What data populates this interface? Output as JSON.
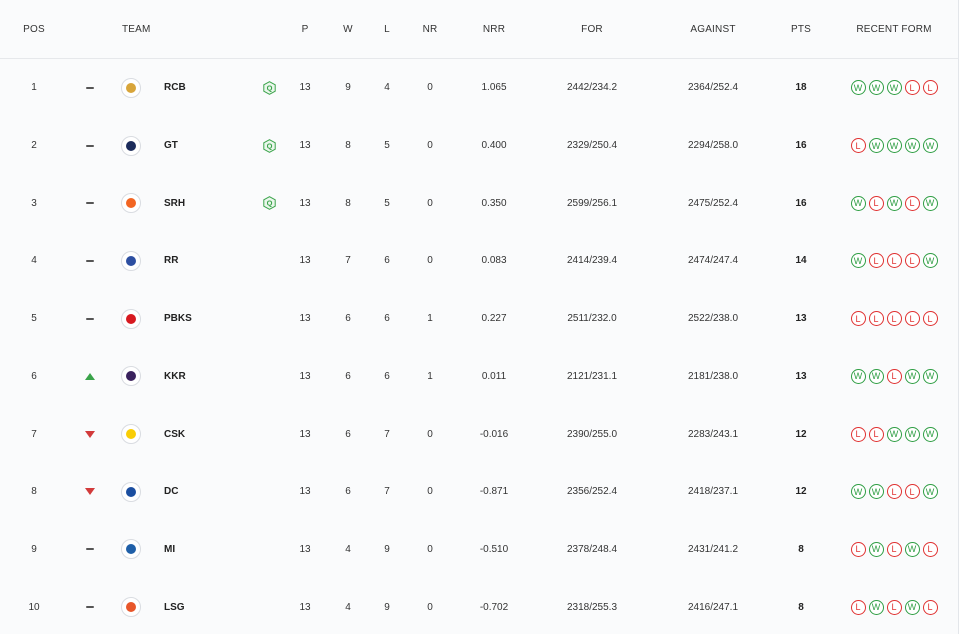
{
  "colors": {
    "win": "#2f9e44",
    "loss": "#e03131",
    "up": "#3aa34a",
    "down": "#d23b3b",
    "qualified": "#3aa34a"
  },
  "header": {
    "pos": "POS",
    "team": "TEAM",
    "p": "P",
    "w": "W",
    "l": "L",
    "nr": "NR",
    "nrr": "NRR",
    "for": "FOR",
    "against": "AGAINST",
    "pts": "PTS",
    "form": "RECENT FORM"
  },
  "rows": [
    {
      "pos": "1",
      "move": "same",
      "team": "RCB",
      "logo_color": "#d8a53a",
      "qualified": true,
      "qualified_label": "Q",
      "p": "13",
      "w": "9",
      "l": "4",
      "nr": "0",
      "nrr": "1.065",
      "for": "2442/234.2",
      "against": "2364/252.4",
      "pts": "18",
      "form": [
        "W",
        "W",
        "W",
        "L",
        "L"
      ]
    },
    {
      "pos": "2",
      "move": "same",
      "team": "GT",
      "logo_color": "#1c2c5b",
      "qualified": true,
      "qualified_label": "Q",
      "p": "13",
      "w": "8",
      "l": "5",
      "nr": "0",
      "nrr": "0.400",
      "for": "2329/250.4",
      "against": "2294/258.0",
      "pts": "16",
      "form": [
        "L",
        "W",
        "W",
        "W",
        "W"
      ]
    },
    {
      "pos": "3",
      "move": "same",
      "team": "SRH",
      "logo_color": "#f26522",
      "qualified": true,
      "qualified_label": "Q",
      "p": "13",
      "w": "8",
      "l": "5",
      "nr": "0",
      "nrr": "0.350",
      "for": "2599/256.1",
      "against": "2475/252.4",
      "pts": "16",
      "form": [
        "W",
        "L",
        "W",
        "L",
        "W"
      ]
    },
    {
      "pos": "4",
      "move": "same",
      "team": "RR",
      "logo_color": "#2d4fa1",
      "qualified": false,
      "qualified_label": "",
      "p": "13",
      "w": "7",
      "l": "6",
      "nr": "0",
      "nrr": "0.083",
      "for": "2414/239.4",
      "against": "2474/247.4",
      "pts": "14",
      "form": [
        "W",
        "L",
        "L",
        "L",
        "W"
      ]
    },
    {
      "pos": "5",
      "move": "same",
      "team": "PBKS",
      "logo_color": "#d71920",
      "qualified": false,
      "qualified_label": "",
      "p": "13",
      "w": "6",
      "l": "6",
      "nr": "1",
      "nrr": "0.227",
      "for": "2511/232.0",
      "against": "2522/238.0",
      "pts": "13",
      "form": [
        "L",
        "L",
        "L",
        "L",
        "L"
      ]
    },
    {
      "pos": "6",
      "move": "up",
      "team": "KKR",
      "logo_color": "#3a225d",
      "qualified": false,
      "qualified_label": "",
      "p": "13",
      "w": "6",
      "l": "6",
      "nr": "1",
      "nrr": "0.011",
      "for": "2121/231.1",
      "against": "2181/238.0",
      "pts": "13",
      "form": [
        "W",
        "W",
        "L",
        "W",
        "W"
      ]
    },
    {
      "pos": "7",
      "move": "down",
      "team": "CSK",
      "logo_color": "#f9cd05",
      "qualified": false,
      "qualified_label": "",
      "p": "13",
      "w": "6",
      "l": "7",
      "nr": "0",
      "nrr": "-0.016",
      "for": "2390/255.0",
      "against": "2283/243.1",
      "pts": "12",
      "form": [
        "L",
        "L",
        "W",
        "W",
        "W"
      ]
    },
    {
      "pos": "8",
      "move": "down",
      "team": "DC",
      "logo_color": "#1b4ea0",
      "qualified": false,
      "qualified_label": "",
      "p": "13",
      "w": "6",
      "l": "7",
      "nr": "0",
      "nrr": "-0.871",
      "for": "2356/252.4",
      "against": "2418/237.1",
      "pts": "12",
      "form": [
        "W",
        "W",
        "L",
        "L",
        "W"
      ]
    },
    {
      "pos": "9",
      "move": "same",
      "team": "MI",
      "logo_color": "#1f5fa8",
      "qualified": false,
      "qualified_label": "",
      "p": "13",
      "w": "4",
      "l": "9",
      "nr": "0",
      "nrr": "-0.510",
      "for": "2378/248.4",
      "against": "2431/241.2",
      "pts": "8",
      "form": [
        "L",
        "W",
        "L",
        "W",
        "L"
      ]
    },
    {
      "pos": "10",
      "move": "same",
      "team": "LSG",
      "logo_color": "#e8562a",
      "qualified": false,
      "qualified_label": "",
      "p": "13",
      "w": "4",
      "l": "9",
      "nr": "0",
      "nrr": "-0.702",
      "for": "2318/255.3",
      "against": "2416/247.1",
      "pts": "8",
      "form": [
        "L",
        "W",
        "L",
        "W",
        "L"
      ]
    }
  ]
}
